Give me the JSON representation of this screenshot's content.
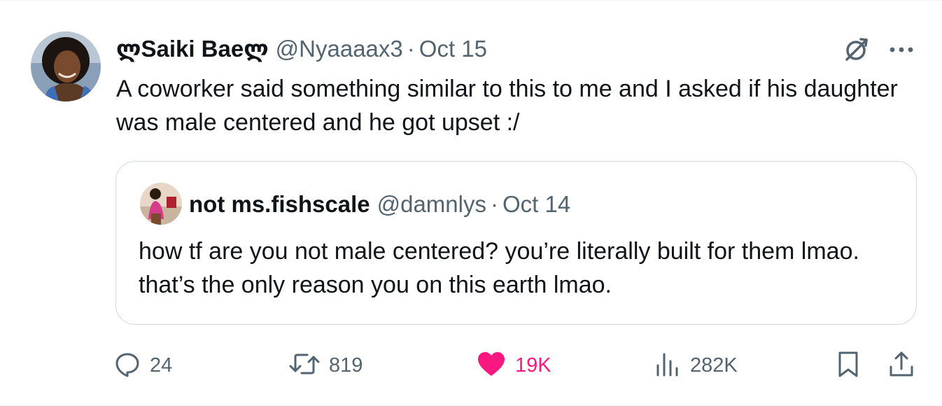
{
  "post": {
    "author": {
      "display_name": "ლSaiki Baeლ",
      "handle": "@Nyaaaax3",
      "avatar": "avatar-photo"
    },
    "separator": "·",
    "date": "Oct 15",
    "text": "A coworker said something similar to this to me and I asked if his daughter was male centered and he got upset :/",
    "header_icons": [
      "grok-icon",
      "more-icon"
    ]
  },
  "quoted": {
    "author": {
      "display_name": "not ms.fishscale",
      "handle": "@damnlys",
      "avatar": "avatar-photo"
    },
    "separator": "·",
    "date": "Oct 14",
    "text": "how tf are you not male centered? you’re literally built for them lmao. that’s the only reason you on this earth lmao."
  },
  "actions": {
    "replies": "24",
    "reposts": "819",
    "likes": "19K",
    "views": "282K",
    "liked": true,
    "icons": [
      "reply-icon",
      "repost-icon",
      "like-icon",
      "views-icon",
      "bookmark-icon",
      "share-icon"
    ]
  },
  "colors": {
    "text_primary": "#0f1419",
    "text_secondary": "#536471",
    "border": "#cfd9de",
    "like": "#f91880"
  }
}
